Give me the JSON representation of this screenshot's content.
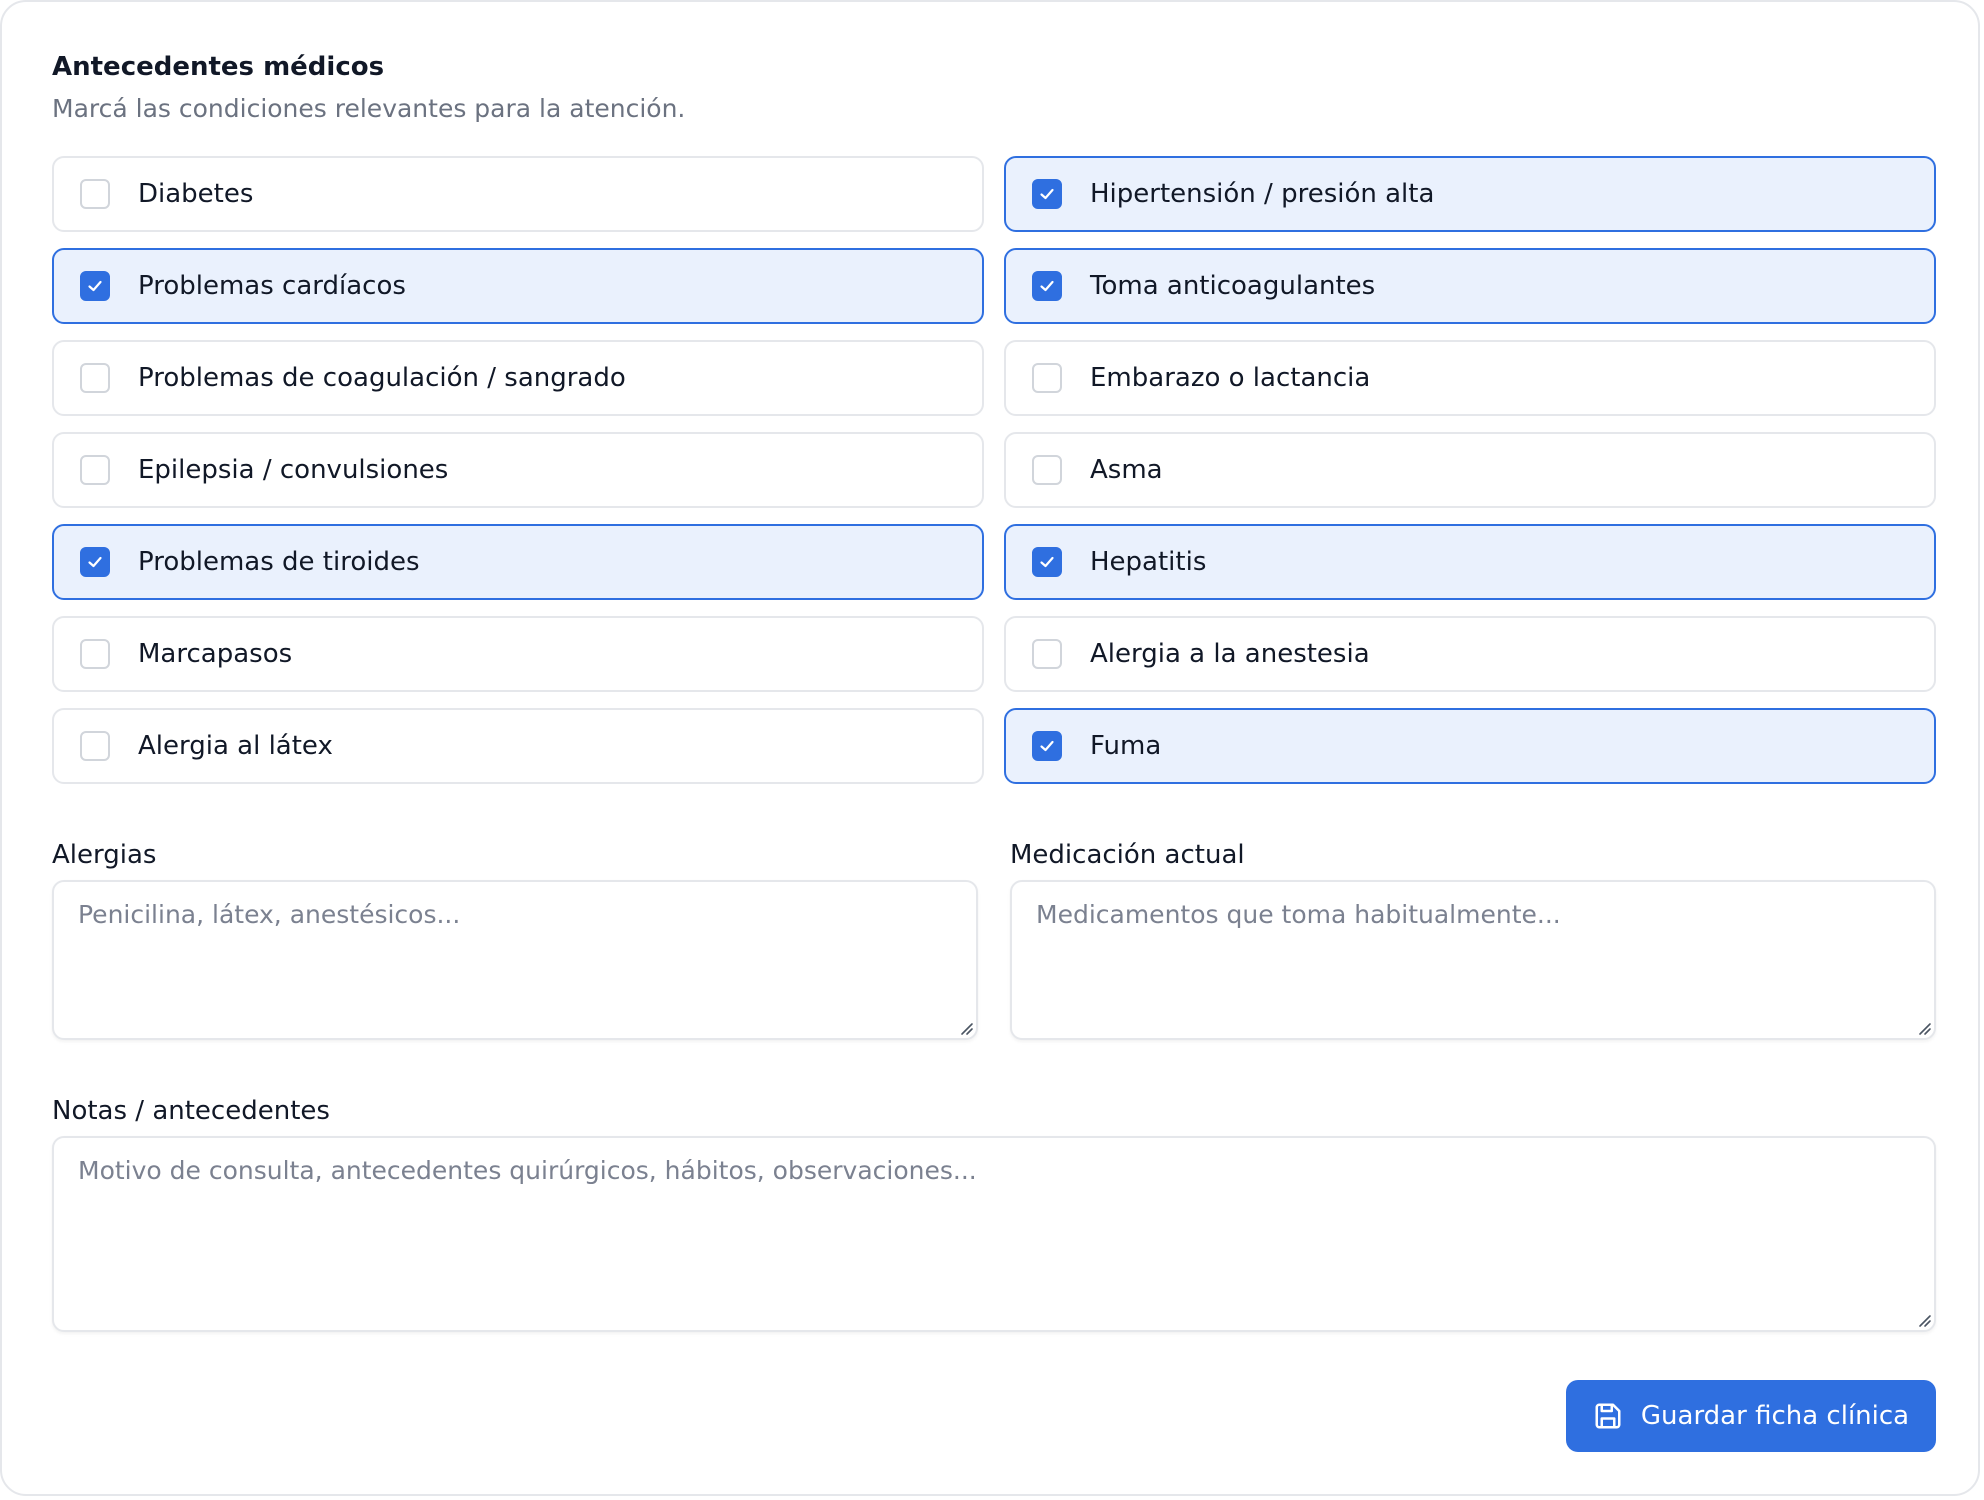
{
  "section": {
    "title": "Antecedentes médicos",
    "subtitle": "Marcá las condiciones relevantes para la atención."
  },
  "conditions": [
    {
      "id": "diabetes",
      "label": "Diabetes",
      "checked": false
    },
    {
      "id": "hipertension",
      "label": "Hipertensión / presión alta",
      "checked": true
    },
    {
      "id": "cardiacos",
      "label": "Problemas cardíacos",
      "checked": true
    },
    {
      "id": "anticoagulantes",
      "label": "Toma anticoagulantes",
      "checked": true
    },
    {
      "id": "coagulacion",
      "label": "Problemas de coagulación / sangrado",
      "checked": false
    },
    {
      "id": "embarazo",
      "label": "Embarazo o lactancia",
      "checked": false
    },
    {
      "id": "epilepsia",
      "label": "Epilepsia / convulsiones",
      "checked": false
    },
    {
      "id": "asma",
      "label": "Asma",
      "checked": false
    },
    {
      "id": "tiroides",
      "label": "Problemas de tiroides",
      "checked": true
    },
    {
      "id": "hepatitis",
      "label": "Hepatitis",
      "checked": true
    },
    {
      "id": "marcapasos",
      "label": "Marcapasos",
      "checked": false
    },
    {
      "id": "anestesia",
      "label": "Alergia a la anestesia",
      "checked": false
    },
    {
      "id": "latex",
      "label": "Alergia al látex",
      "checked": false
    },
    {
      "id": "fuma",
      "label": "Fuma",
      "checked": true
    }
  ],
  "fields": {
    "alergias": {
      "label": "Alergias",
      "value": "",
      "placeholder": "Penicilina, látex, anestésicos..."
    },
    "medicacion": {
      "label": "Medicación actual",
      "value": "",
      "placeholder": "Medicamentos que toma habitualmente..."
    },
    "notas": {
      "label": "Notas / antecedentes",
      "value": "",
      "placeholder": "Motivo de consulta, antecedentes quirúrgicos, hábitos, observaciones..."
    }
  },
  "save_button": {
    "label": "Guardar ficha clínica",
    "icon": "save-icon"
  },
  "colors": {
    "accent": "#2f6fe0",
    "checked_bg": "#eaf1fd",
    "border": "#e5e7eb",
    "muted": "#6b7280"
  }
}
